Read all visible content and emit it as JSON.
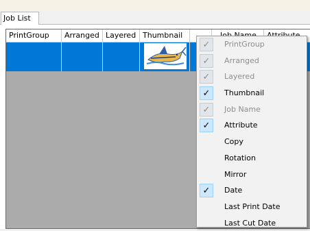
{
  "window": {
    "tab_label": "Job List"
  },
  "grid": {
    "columns": [
      {
        "label": "PrintGroup"
      },
      {
        "label": "Arranged"
      },
      {
        "label": "Layered"
      },
      {
        "label": "Thumbnail"
      },
      {
        "label": ""
      },
      {
        "label": "Job Name"
      },
      {
        "label": "Attribute"
      }
    ],
    "selected_row": {
      "thumbnail": "swordfish-thumbnail-icon"
    }
  },
  "context_menu": {
    "items": [
      {
        "label": "PrintGroup",
        "checked": true,
        "enabled": false
      },
      {
        "label": "Arranged",
        "checked": true,
        "enabled": false
      },
      {
        "label": "Layered",
        "checked": true,
        "enabled": false
      },
      {
        "label": "Thumbnail",
        "checked": true,
        "enabled": true
      },
      {
        "label": "Job Name",
        "checked": true,
        "enabled": false
      },
      {
        "label": "Attribute",
        "checked": true,
        "enabled": true
      },
      {
        "label": "Copy",
        "checked": false,
        "enabled": true
      },
      {
        "label": "Rotation",
        "checked": false,
        "enabled": true
      },
      {
        "label": "Mirror",
        "checked": false,
        "enabled": true
      },
      {
        "label": "Date",
        "checked": true,
        "enabled": true
      },
      {
        "label": "Last Print Date",
        "checked": false,
        "enabled": true
      },
      {
        "label": "Last Cut Date",
        "checked": false,
        "enabled": true
      }
    ]
  },
  "colors": {
    "selection": "#0078d7",
    "grid_background": "#ababab",
    "check_highlight": "#cce8ff"
  }
}
